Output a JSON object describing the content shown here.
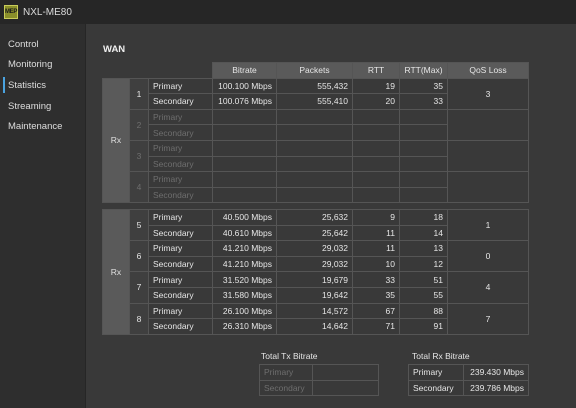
{
  "app": {
    "logo_text": "MEP",
    "title": "NXL-ME80"
  },
  "sidebar": {
    "items": [
      {
        "label": "Control",
        "active": false
      },
      {
        "label": "Monitoring",
        "active": false
      },
      {
        "label": "Statistics",
        "active": true
      },
      {
        "label": "Streaming",
        "active": false
      },
      {
        "label": "Maintenance",
        "active": false
      }
    ]
  },
  "wan": {
    "title": "WAN",
    "columns": [
      "Bitrate",
      "Packets",
      "RTT",
      "RTT(Max)",
      "QoS Loss"
    ],
    "primary_label": "Primary",
    "secondary_label": "Secondary",
    "group1": {
      "label": "Rx",
      "streams": [
        {
          "num": "1",
          "primary": {
            "bitrate": "100.100 Mbps",
            "packets": "555,432",
            "rtt": "19",
            "rtt_max": "35"
          },
          "secondary": {
            "bitrate": "100.076 Mbps",
            "packets": "555,410",
            "rtt": "20",
            "rtt_max": "33"
          },
          "qos_loss": "3"
        },
        {
          "num": "2",
          "primary": {
            "bitrate": "",
            "packets": "",
            "rtt": "",
            "rtt_max": ""
          },
          "secondary": {
            "bitrate": "",
            "packets": "",
            "rtt": "",
            "rtt_max": ""
          },
          "qos_loss": ""
        },
        {
          "num": "3",
          "primary": {
            "bitrate": "",
            "packets": "",
            "rtt": "",
            "rtt_max": ""
          },
          "secondary": {
            "bitrate": "",
            "packets": "",
            "rtt": "",
            "rtt_max": ""
          },
          "qos_loss": ""
        },
        {
          "num": "4",
          "primary": {
            "bitrate": "",
            "packets": "",
            "rtt": "",
            "rtt_max": ""
          },
          "secondary": {
            "bitrate": "",
            "packets": "",
            "rtt": "",
            "rtt_max": ""
          },
          "qos_loss": ""
        }
      ]
    },
    "group2": {
      "label": "Rx",
      "streams": [
        {
          "num": "5",
          "primary": {
            "bitrate": "40.500 Mbps",
            "packets": "25,632",
            "rtt": "9",
            "rtt_max": "18"
          },
          "secondary": {
            "bitrate": "40.610 Mbps",
            "packets": "25,642",
            "rtt": "11",
            "rtt_max": "14"
          },
          "qos_loss": "1"
        },
        {
          "num": "6",
          "primary": {
            "bitrate": "41.210 Mbps",
            "packets": "29,032",
            "rtt": "11",
            "rtt_max": "13"
          },
          "secondary": {
            "bitrate": "41.210 Mbps",
            "packets": "29,032",
            "rtt": "10",
            "rtt_max": "12"
          },
          "qos_loss": "0"
        },
        {
          "num": "7",
          "primary": {
            "bitrate": "31.520 Mbps",
            "packets": "19,679",
            "rtt": "33",
            "rtt_max": "51"
          },
          "secondary": {
            "bitrate": "31.580 Mbps",
            "packets": "19,642",
            "rtt": "35",
            "rtt_max": "55"
          },
          "qos_loss": "4"
        },
        {
          "num": "8",
          "primary": {
            "bitrate": "26.100 Mbps",
            "packets": "14,572",
            "rtt": "67",
            "rtt_max": "88"
          },
          "secondary": {
            "bitrate": "26.310 Mbps",
            "packets": "14,642",
            "rtt": "71",
            "rtt_max": "91"
          },
          "qos_loss": "7"
        }
      ]
    }
  },
  "totals": {
    "tx": {
      "title": "Total Tx Bitrate",
      "primary_label": "Primary",
      "primary_value": "",
      "secondary_label": "Secondary",
      "secondary_value": ""
    },
    "rx": {
      "title": "Total Rx Bitrate",
      "primary_label": "Primary",
      "primary_value": "239.430 Mbps",
      "secondary_label": "Secondary",
      "secondary_value": "239.786 Mbps"
    }
  },
  "colors": {
    "accent": "#4aa3e0",
    "header_bg": "#5a5a5a",
    "background": "#393939"
  }
}
